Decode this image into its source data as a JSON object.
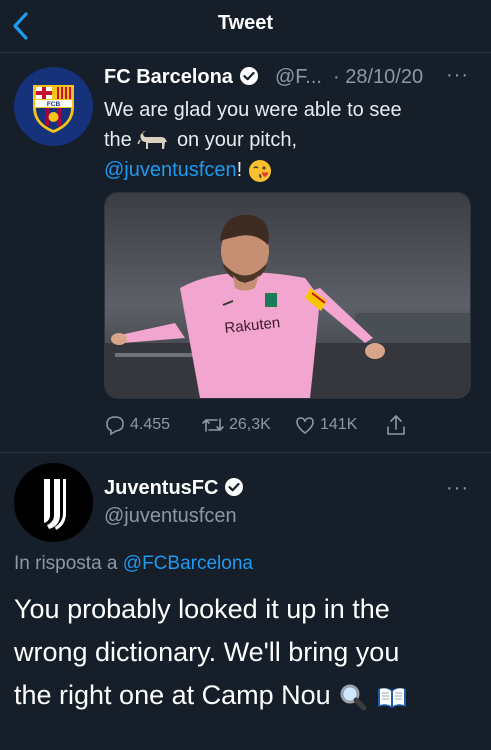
{
  "header": {
    "title": "Tweet",
    "back_icon": "chevron-left-icon"
  },
  "barca": {
    "avatar_icon": "fc-barcelona-crest-icon",
    "name": "FC Barcelona",
    "handle": "@F...",
    "date": "· 28/10/20",
    "text_line1": "We are glad you were able to see",
    "text_line2_start": "the",
    "goat_icon": "goat-emoji-icon",
    "text_line2_end": "on your pitch,",
    "mention": "@juventusfcen",
    "text_after_mention": "!",
    "wink_icon": "kiss-wink-emoji-icon",
    "media_alt": "Player in pink kit",
    "media_sponsor": "Rakuten",
    "stats": {
      "replies": "4.455",
      "retweets": "26,3K",
      "likes": "141K"
    }
  },
  "juve": {
    "avatar_icon": "juventus-logo-icon",
    "name": "JuventusFC",
    "handle": "@juventusfcen",
    "reply_to_prefix": "In risposta a",
    "reply_to_handle": "@FCBarcelona",
    "line1": "You probably looked it up in the",
    "line2": "wrong dictionary. We'll bring you",
    "line3": "the right one at Camp Nou",
    "magnifier_icon": "magnifying-glass-emoji-icon",
    "book_icon": "open-book-emoji-icon"
  },
  "colors": {
    "background": "#151e29",
    "accent": "#1d9bf0",
    "muted": "#8b98a5",
    "barca_blue": "#16327a",
    "kit_pink": "#f2a6cf"
  }
}
